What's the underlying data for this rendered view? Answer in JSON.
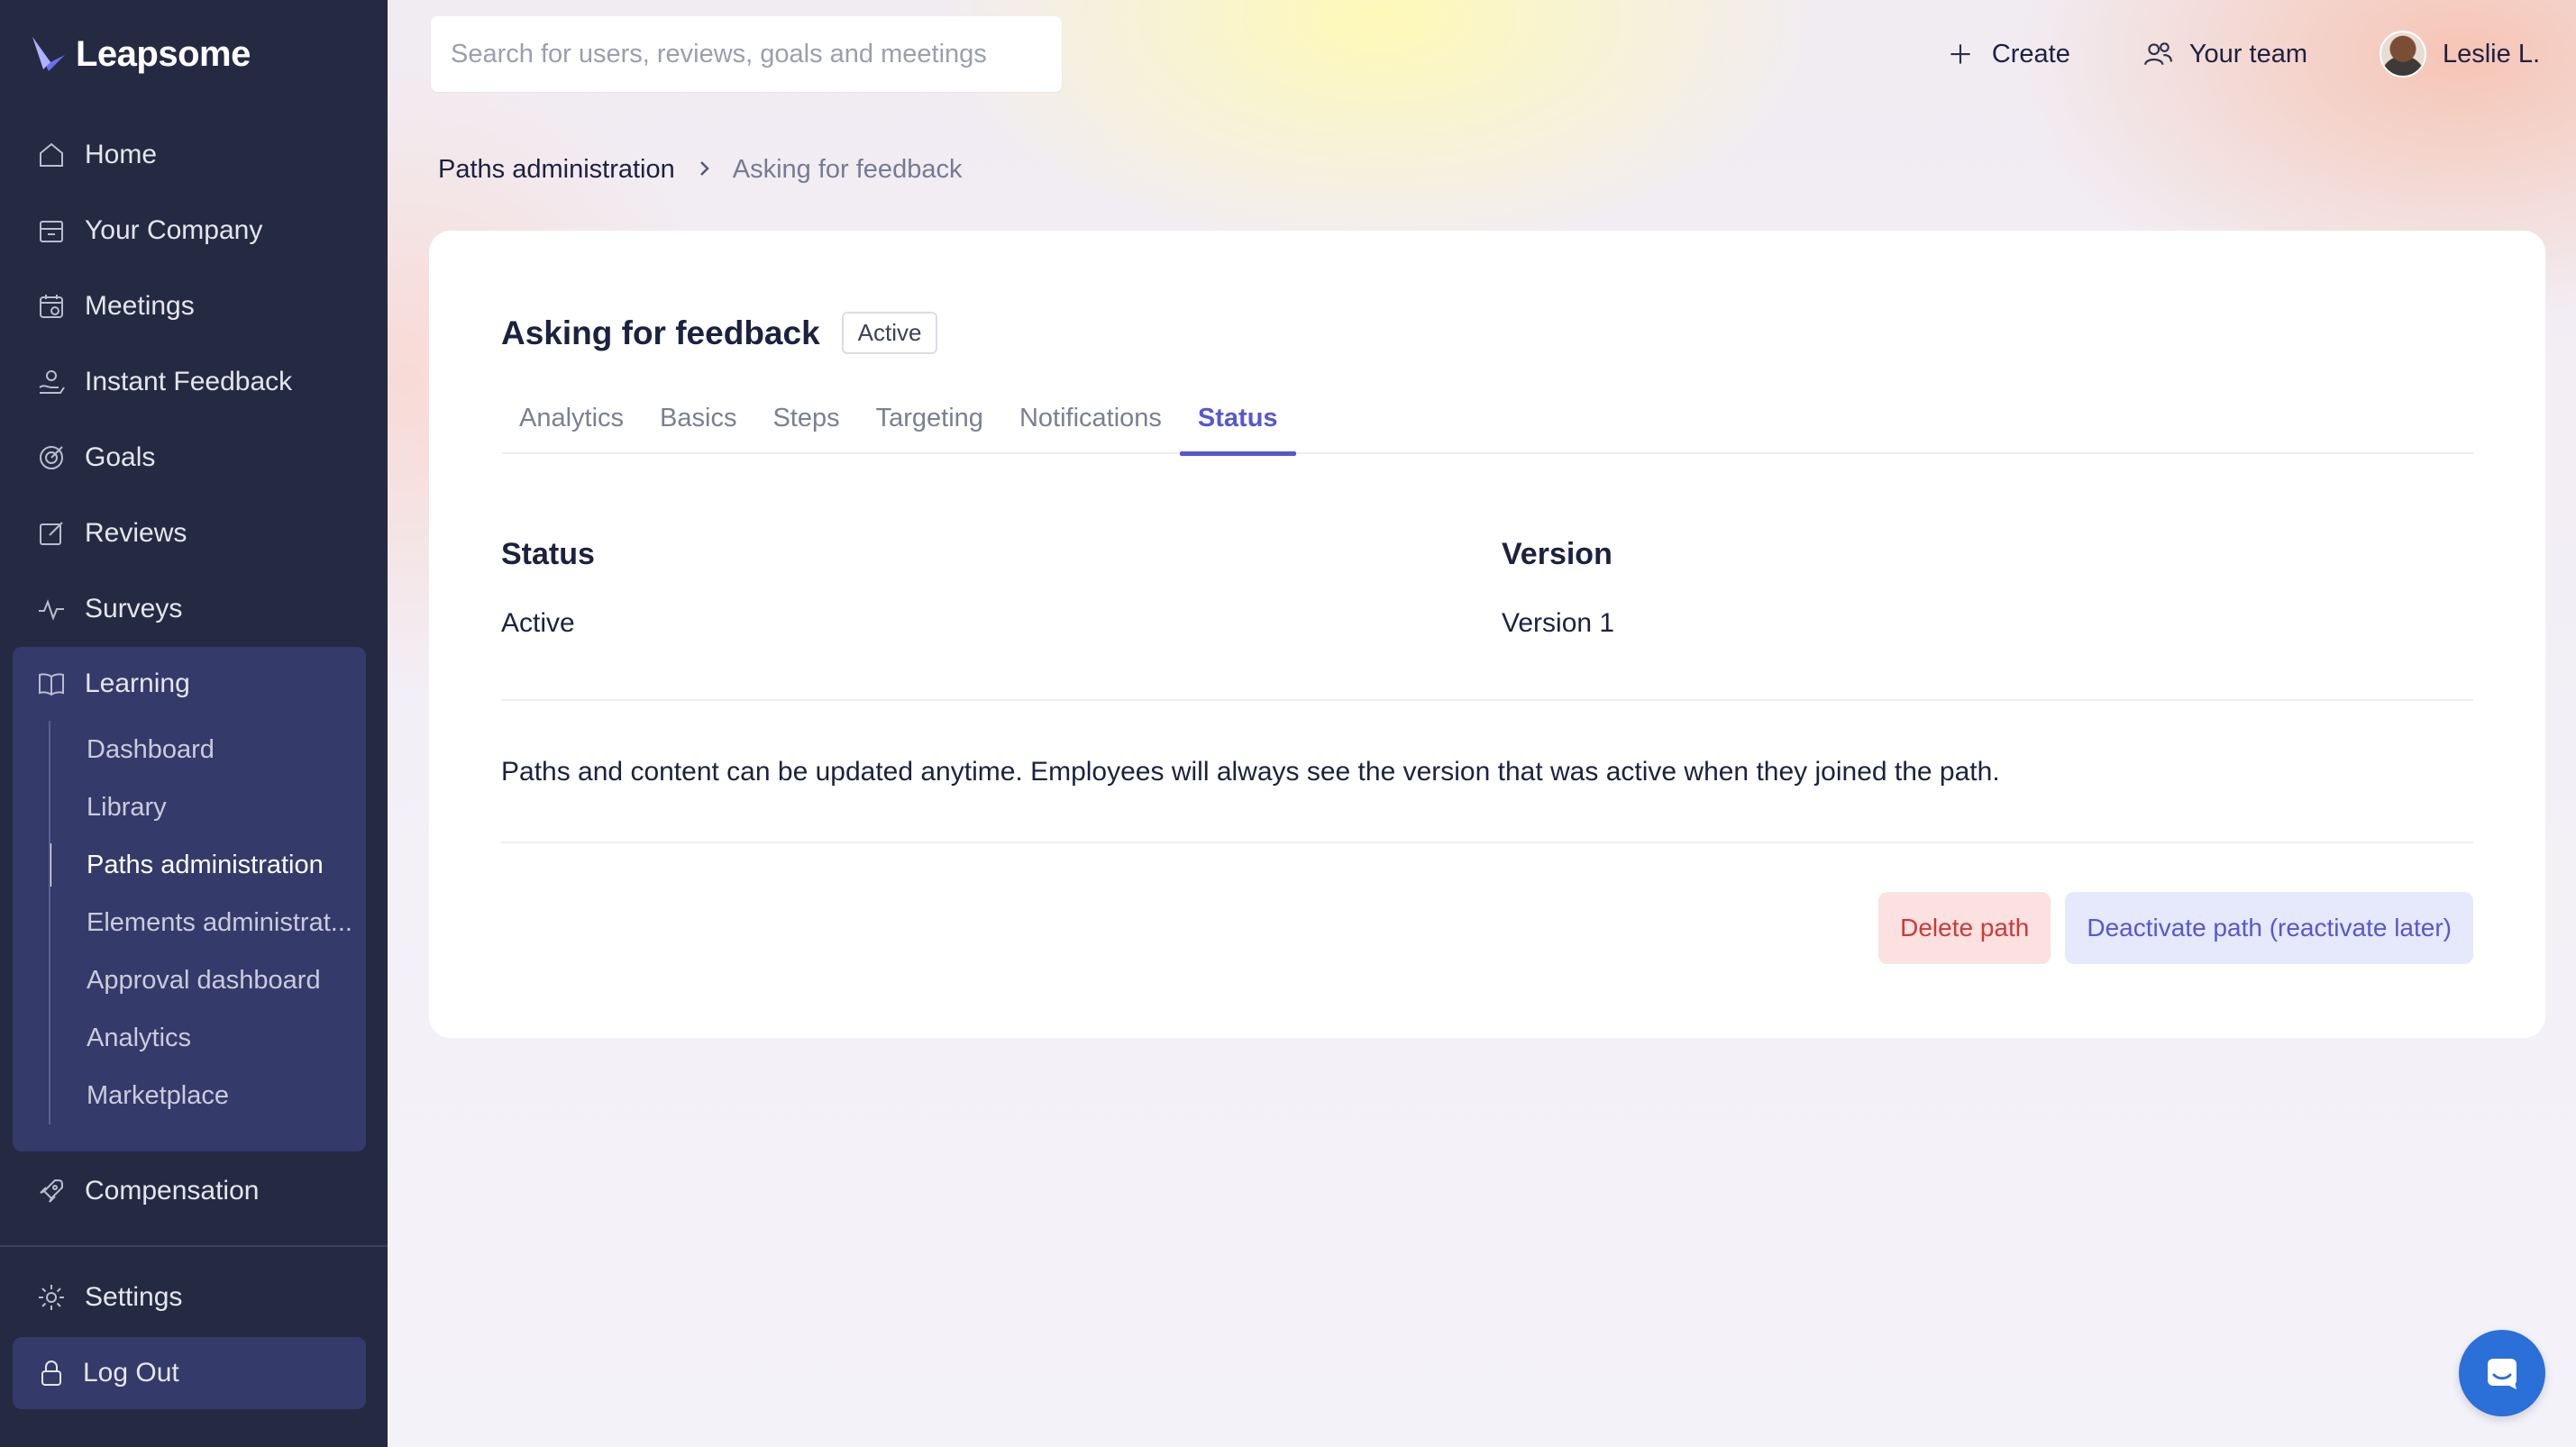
{
  "app": {
    "brand": "Leapsome",
    "brand_color": "#252a43",
    "accent": "#5757d0"
  },
  "sidebar": {
    "items": [
      {
        "label": "Home",
        "icon": "home-icon"
      },
      {
        "label": "Your Company",
        "icon": "building-icon"
      },
      {
        "label": "Meetings",
        "icon": "calendar-icon"
      },
      {
        "label": "Instant Feedback",
        "icon": "feedback-icon"
      },
      {
        "label": "Goals",
        "icon": "target-icon"
      },
      {
        "label": "Reviews",
        "icon": "edit-icon"
      },
      {
        "label": "Surveys",
        "icon": "pulse-icon"
      }
    ],
    "learning": {
      "label": "Learning",
      "icon": "book-icon",
      "subitems": [
        {
          "label": "Dashboard"
        },
        {
          "label": "Library"
        },
        {
          "label": "Paths administration",
          "active": true
        },
        {
          "label": "Elements administrat..."
        },
        {
          "label": "Approval dashboard"
        },
        {
          "label": "Analytics"
        },
        {
          "label": "Marketplace"
        }
      ]
    },
    "compensation": {
      "label": "Compensation",
      "icon": "rocket-icon"
    },
    "settings": {
      "label": "Settings",
      "icon": "gear-icon"
    },
    "logout": {
      "label": "Log Out",
      "icon": "lock-icon"
    }
  },
  "topbar": {
    "search_placeholder": "Search for users, reviews, goals and meetings",
    "create_label": "Create",
    "team_label": "Your team",
    "user_name": "Leslie L."
  },
  "breadcrumb": {
    "parent": "Paths administration",
    "current": "Asking for feedback"
  },
  "page": {
    "title": "Asking for feedback",
    "badge": "Active",
    "tabs": [
      {
        "label": "Analytics"
      },
      {
        "label": "Basics"
      },
      {
        "label": "Steps"
      },
      {
        "label": "Targeting"
      },
      {
        "label": "Notifications"
      },
      {
        "label": "Status",
        "active": true
      }
    ],
    "status_label": "Status",
    "status_value": "Active",
    "version_label": "Version",
    "version_value": "Version 1",
    "note": "Paths and content can be updated anytime. Employees will always see the version that was active when they joined the path.",
    "delete_label": "Delete path",
    "deactivate_label": "Deactivate path (reactivate later)"
  }
}
